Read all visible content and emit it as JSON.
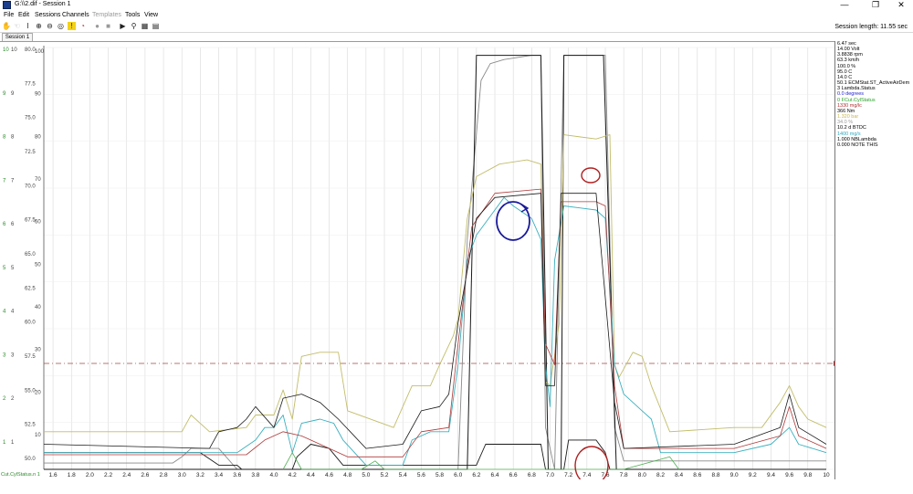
{
  "window": {
    "title": "G:\\\\2.dif - Session 1",
    "minimize": "—",
    "maximize": "❐",
    "close": "✕"
  },
  "menu": [
    "File",
    "Edit",
    "Sessions",
    "Channels",
    "Templates",
    "Tools",
    "View"
  ],
  "toolbar_icons": [
    "hand-icon",
    "pointer-icon",
    "cursor-icon",
    "zoom-in-icon",
    "zoom-out-icon",
    "zoom-reset-icon",
    "marker-icon",
    "speed-icon",
    "record-icon",
    "stop-icon",
    "play-icon",
    "find-icon",
    "table-icon",
    "grid-icon"
  ],
  "session": {
    "tab_label": "Session 1",
    "length_text": "Session length: 11.55 sec"
  },
  "colors": {
    "grid": "#d9d9d9",
    "gray": "#8a8a8a",
    "black": "#1a1a1a",
    "olive": "#c2bd6a",
    "teal": "#3ab0bf",
    "red": "#b03a3a",
    "green": "#4caf50",
    "navy": "#22228c",
    "refline": "#a04848",
    "annotation_red": "#b02020",
    "annotation_blue": "#1a1a9a"
  },
  "legend": [
    {
      "text": "6.47 sec",
      "color": "#000000"
    },
    {
      "text": "14.00 Volt",
      "color": "#000000"
    },
    {
      "text": "3.8838 rpm",
      "color": "#000000"
    },
    {
      "text": "63.3 km/h",
      "color": "#000000"
    },
    {
      "text": "100.0 %",
      "color": "#000000"
    },
    {
      "text": "95.0 C",
      "color": "#000000"
    },
    {
      "text": "14.0 C",
      "color": "#000000"
    },
    {
      "text": "50.1 ECMStat.ST_ActiveAirDem",
      "color": "#000000"
    },
    {
      "text": "3 Lambda.Status",
      "color": "#000000"
    },
    {
      "text": "0.0 degrees",
      "color": "#1a1ad0"
    },
    {
      "text": "0 FCut.CylStatus",
      "color": "#2aa02a"
    },
    {
      "text": "1330 mg/lc",
      "color": "#b03030"
    },
    {
      "text": "366 Nm",
      "color": "#000000"
    },
    {
      "text": "1.320 bar",
      "color": "#c8b84a"
    },
    {
      "text": "34.0 %",
      "color": "#9a9a9a"
    },
    {
      "text": "10.2 d BTDC",
      "color": "#000000"
    },
    {
      "text": "1400 mg/s",
      "color": "#30a8c0"
    },
    {
      "text": "1.000 NBLambda",
      "color": "#000000"
    },
    {
      "text": "0.000 NOTE THIS",
      "color": "#000000"
    }
  ],
  "axes": {
    "x_ticks": [
      "1.6",
      "1.8",
      "2.0",
      "2.2",
      "2.4",
      "2.6",
      "2.8",
      "3.0",
      "3.2",
      "3.4",
      "3.6",
      "3.8",
      "4.0",
      "4.2",
      "4.4",
      "4.6",
      "4.8",
      "5.0",
      "5.2",
      "5.4",
      "5.6",
      "5.8",
      "6.0",
      "6.2",
      "6.4",
      "6.6",
      "6.8",
      "7.0",
      "7.2",
      "7.4",
      "7.6",
      "7.8",
      "8.0",
      "8.2",
      "8.4",
      "8.6",
      "8.8",
      "9.0",
      "9.2",
      "9.4",
      "9.6",
      "9.8",
      "10"
    ],
    "y_col1": [
      "10",
      "9",
      "8",
      "7",
      "6",
      "5",
      "4",
      "3",
      "2",
      "1"
    ],
    "y_col2": [
      "10",
      "9",
      "8",
      "7",
      "6",
      "5",
      "4",
      "3",
      "2",
      "1"
    ],
    "y_col3_a": [
      "80.0",
      "77.5",
      "75.0",
      "72.5",
      "70.0",
      "67.5",
      "65.0",
      "62.5",
      "60.0",
      "57.5",
      "55.0",
      "52.5",
      "50.0"
    ],
    "y_col3_b": [
      "100",
      "90",
      "80",
      "70",
      "60",
      "50",
      "40",
      "30",
      "20",
      "10"
    ],
    "y_bottom_label": "Cut.CylStatus.n 1"
  }
}
